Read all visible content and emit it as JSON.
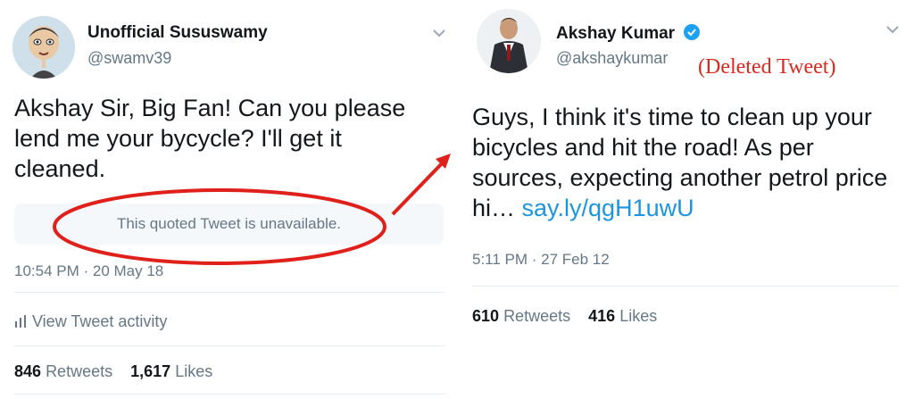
{
  "left_tweet": {
    "display_name": "Unofficial Sususwamy",
    "handle": "@swamv39",
    "text": "Akshay Sir, Big Fan! Can you please lend me your bycycle? I'll get it cleaned.",
    "quoted_notice": "This quoted Tweet is unavailable.",
    "timestamp": "10:54 PM · 20 May 18",
    "activity_label": "View Tweet activity",
    "retweets_count": "846",
    "retweets_label": "Retweets",
    "likes_count": "1,617",
    "likes_label": "Likes"
  },
  "right_tweet": {
    "display_name": "Akshay Kumar",
    "handle": "@akshaykumar",
    "annotation": "(Deleted Tweet)",
    "text_main": "Guys, I think it's time to clean up your bicycles  and hit the road! As per sources, expecting another petrol price hi… ",
    "link": "say.ly/qgH1uwU",
    "timestamp": "5:11 PM · 27 Feb 12",
    "retweets_count": "610",
    "retweets_label": "Retweets",
    "likes_count": "416",
    "likes_label": "Likes"
  },
  "colors": {
    "text": "#14171a",
    "secondary": "#657786",
    "link": "#1b95e0",
    "verified": "#1da1f2",
    "annotation_red": "#d62a1e"
  },
  "icons": [
    "chevron-down-icon",
    "verified-badge-icon",
    "bar-chart-icon",
    "arrow-annotation",
    "ellipse-annotation"
  ]
}
